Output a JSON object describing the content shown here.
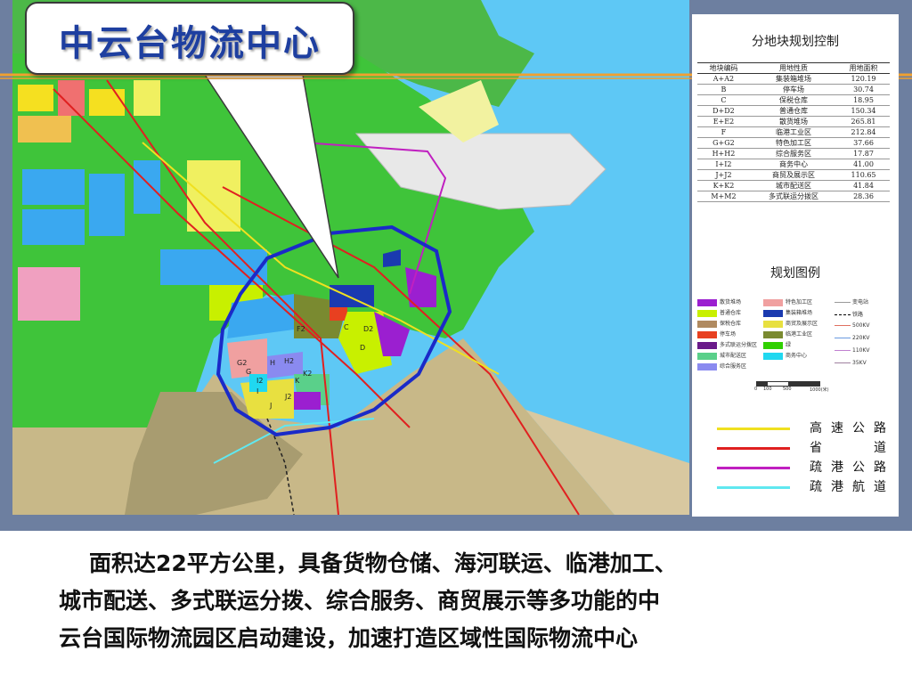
{
  "slide_title": "中云台物流中心",
  "table": {
    "title": "分地块规划控制",
    "headers": [
      "地块编码",
      "用地性质",
      "用地面积"
    ],
    "rows": [
      {
        "code": "A+A2",
        "use": "集装箱堆场",
        "area": "120.19"
      },
      {
        "code": "B",
        "use": "停车场",
        "area": "30.74"
      },
      {
        "code": "C",
        "use": "保税仓库",
        "area": "18.95"
      },
      {
        "code": "D+D2",
        "use": "普通仓库",
        "area": "150.34"
      },
      {
        "code": "E+E2",
        "use": "散货堆场",
        "area": "265.81"
      },
      {
        "code": "F",
        "use": "临港工业区",
        "area": "212.84"
      },
      {
        "code": "G+G2",
        "use": "特色加工区",
        "area": "37.66"
      },
      {
        "code": "H+H2",
        "use": "综合服务区",
        "area": "17.87"
      },
      {
        "code": "I+I2",
        "use": "商务中心",
        "area": "41.00"
      },
      {
        "code": "J+J2",
        "use": "商贸及展示区",
        "area": "110.65"
      },
      {
        "code": "K+K2",
        "use": "城市配送区",
        "area": "41.84"
      },
      {
        "code": "M+M2",
        "use": "多式联运分拨区",
        "area": "28.36"
      }
    ]
  },
  "legend": {
    "title": "规划图例",
    "left_items": [
      {
        "label": "散货堆场",
        "color": "#9b1fd0"
      },
      {
        "label": "普通仓库",
        "color": "#c8f000"
      },
      {
        "label": "保税仓库",
        "color": "#b08a60"
      },
      {
        "label": "停车场",
        "color": "#e84020"
      },
      {
        "label": "多式联运分拨区",
        "color": "#6a1a8a"
      },
      {
        "label": "城市配送区",
        "color": "#5ad08a"
      },
      {
        "label": "综合服务区",
        "color": "#8a8af0"
      }
    ],
    "right_items": [
      {
        "label": "特色加工区",
        "color": "#f0a0a0"
      },
      {
        "label": "集装箱堆场",
        "color": "#1a3ab0"
      },
      {
        "label": "商贸及展示区",
        "color": "#e8e040"
      },
      {
        "label": "临港工业区",
        "color": "#7a8a30"
      },
      {
        "label": "绿",
        "color": "#30d000"
      },
      {
        "label": "商务中心",
        "color": "#20d8f0"
      }
    ],
    "line_items": [
      {
        "label": "变电站",
        "color": "#999999"
      },
      {
        "label": "铁路",
        "color": "#000000"
      },
      {
        "label": "500KV",
        "color": "#e07060"
      },
      {
        "label": "220KV",
        "color": "#6a9ae0"
      },
      {
        "label": "110KV",
        "color": "#c080d0"
      },
      {
        "label": "35KV",
        "color": "#a080a0"
      }
    ],
    "scale": {
      "labels": [
        "0",
        "100",
        "500",
        "1000(米)"
      ]
    }
  },
  "roads": [
    {
      "label": "高速公路",
      "color": "#f0e020"
    },
    {
      "label": "省道",
      "color": "#e02020"
    },
    {
      "label": "疏港公路",
      "color": "#c020c0"
    },
    {
      "label": "疏港航道",
      "color": "#60e8f0"
    }
  ],
  "map_labels": [
    "F2",
    "C",
    "D2",
    "D",
    "G2",
    "G",
    "H",
    "H2",
    "I2",
    "K",
    "K2",
    "J",
    "J2",
    "I"
  ],
  "caption": {
    "line1": "面积达22平方公里，具备货物仓储、海河联运、临港加工、",
    "line2": "城市配送、多式联运分拨、综合服务、商贸展示等多功能的中",
    "line3": "云台国际物流园区启动建设，加速打造区域性国际物流中心"
  }
}
